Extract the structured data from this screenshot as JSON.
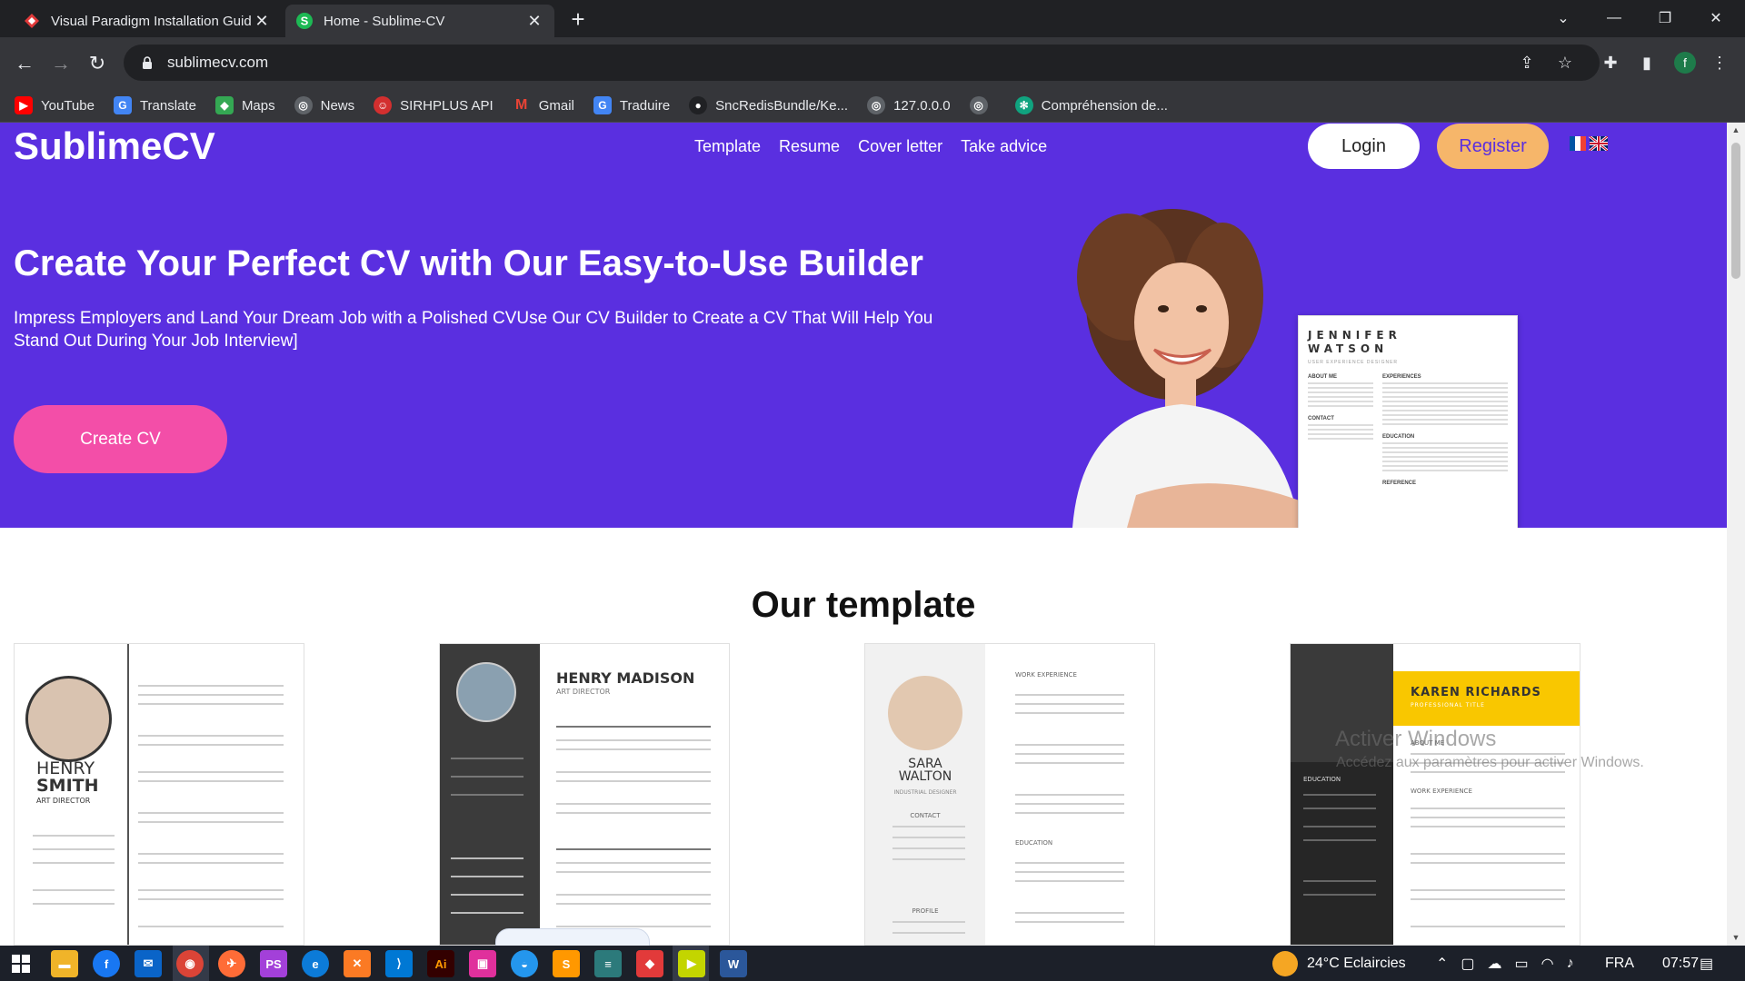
{
  "browser": {
    "tabs": [
      {
        "title": "Visual Paradigm Installation Guid",
        "active": false
      },
      {
        "title": "Home - Sublime-CV",
        "active": true
      }
    ],
    "url": "sublimecv.com",
    "bookmarks": [
      "YouTube",
      "Translate",
      "Maps",
      "News",
      "SIRHPLUS API",
      "Gmail",
      "Traduire",
      "SncRedisBundle/Ke...",
      "127.0.0.0",
      "",
      "Compréhension de..."
    ]
  },
  "site": {
    "brand": "SublimeCV",
    "nav": [
      "Template",
      "Resume",
      "Cover letter",
      "Take advice"
    ],
    "login": "Login",
    "register": "Register",
    "hero_title": "Create Your Perfect CV with Our Easy-to-Use Builder",
    "hero_subtitle": "Impress Employers and Land Your Dream Job with a Polished CVUse Our CV Builder to Create a CV That Will Help You Stand Out During Your Job Interview]",
    "create_cv": "Create CV",
    "hero_cv_name": "JENNIFER\nWATSON",
    "hero_cv_role": "USER EXPERIENCE DESIGNER",
    "hero_cv_sections": [
      "ABOUT ME",
      "EXPERIENCES",
      "CONTACT",
      "EDUCATION",
      "REFERENCE"
    ],
    "templates_title": "Our template",
    "templates": [
      {
        "first": "HENRY",
        "last": "SMITH",
        "role": "ART DIRECTOR"
      },
      {
        "name": "HENRY MADISON",
        "role": "ART DIRECTOR"
      },
      {
        "first": "SARA",
        "last": "WALTON",
        "role": "INDUSTRIAL DESIGNER",
        "sections": [
          "WORK EXPERIENCE",
          "CONTACT",
          "EDUCATION",
          "PROFILE"
        ]
      },
      {
        "name": "KAREN RICHARDS",
        "role": "PROFESSIONAL TITLE",
        "sections": [
          "ABOUT ME",
          "WORK EXPERIENCE",
          "EDUCATION"
        ]
      }
    ]
  },
  "windows": {
    "watermark_title": "Activer Windows",
    "watermark_sub": "Accédez aux paramètres pour activer Windows.",
    "weather": "24°C  Eclaircies",
    "lang": "FRA",
    "time": "07:57"
  },
  "colors": {
    "hero_bg": "#5a2fe0",
    "register_bg": "#f6b66a",
    "create_bg": "#f34ea8"
  }
}
